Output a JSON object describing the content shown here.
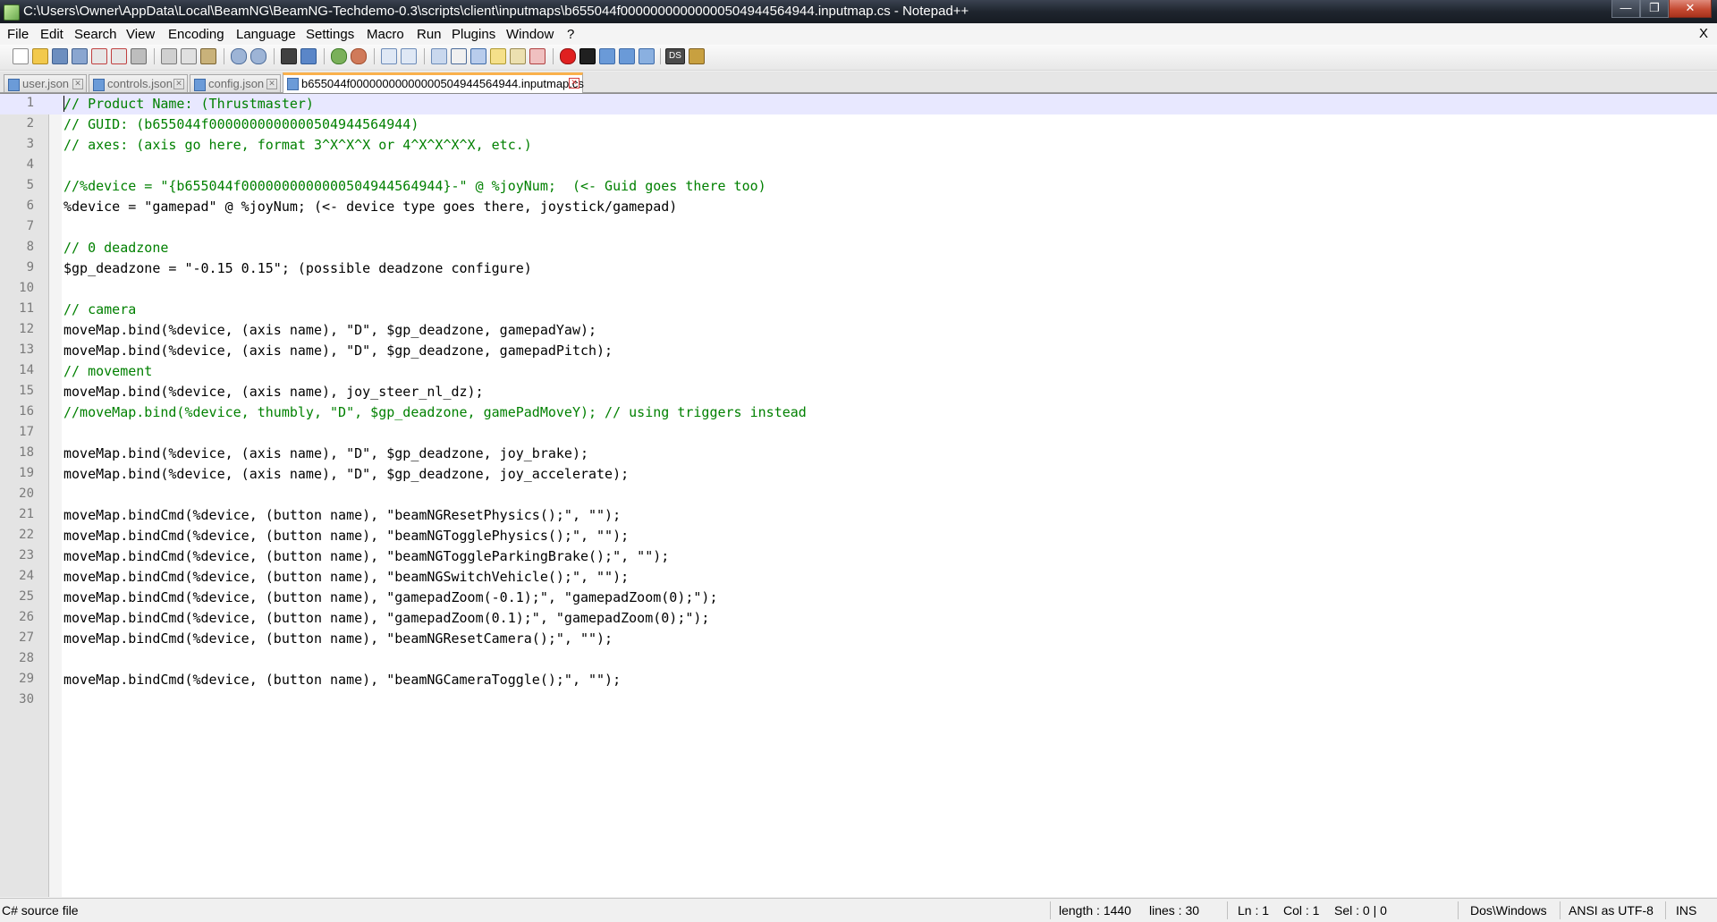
{
  "window": {
    "title": "C:\\Users\\Owner\\AppData\\Local\\BeamNG\\BeamNG-Techdemo-0.3\\scripts\\client\\inputmaps\\b655044f00000000000000504944564944.inputmap.cs - Notepad++",
    "minimize_label": "—",
    "maximize_label": "❐",
    "close_label": "✕"
  },
  "menu": {
    "items": [
      "File",
      "Edit",
      "Search",
      "View",
      "Encoding",
      "Language",
      "Settings",
      "Macro",
      "Run",
      "Plugins",
      "Window",
      "?"
    ],
    "close_label": "X"
  },
  "toolbar": {
    "icons": [
      "new-file-icon",
      "open-file-icon",
      "save-icon",
      "save-all-icon",
      "close-icon",
      "close-all-icon",
      "print-icon",
      "cut-icon",
      "copy-icon",
      "paste-icon",
      "undo-icon",
      "redo-icon",
      "find-icon",
      "replace-icon",
      "zoom-in-icon",
      "zoom-out-icon",
      "sync-vertical-icon",
      "sync-horizontal-icon",
      "word-wrap-icon",
      "show-all-chars-icon",
      "indent-guide-icon",
      "user-language-icon",
      "doc-map-icon",
      "function-list-icon",
      "record-macro-icon",
      "stop-macro-icon",
      "play-macro-icon",
      "run-macro-multiple-icon",
      "save-macro-icon",
      "ds-plugin-icon",
      "plugin-icon"
    ],
    "ds_label": "DS"
  },
  "tabs": [
    {
      "label": "user.json",
      "active": false
    },
    {
      "label": "controls.json",
      "active": false
    },
    {
      "label": "config.json",
      "active": false
    },
    {
      "label": "b655044f00000000000000504944564944.inputmap.cs",
      "active": true
    }
  ],
  "editor": {
    "lines": [
      {
        "n": "1",
        "text": "// Product Name: (Thrustmaster)",
        "kind": "comment"
      },
      {
        "n": "2",
        "text": "// GUID: (b655044f0000000000000504944564944)",
        "kind": "comment"
      },
      {
        "n": "3",
        "text": "// axes: (axis go here, format 3^X^X^X or 4^X^X^X^X, etc.)",
        "kind": "comment"
      },
      {
        "n": "4",
        "text": "",
        "kind": "code"
      },
      {
        "n": "5",
        "text": "//%device = \"{b655044f0000000000000504944564944}-\" @ %joyNum;  (<- Guid goes there too)",
        "kind": "comment"
      },
      {
        "n": "6",
        "text": "%device = \"gamepad\" @ %joyNum; (<- device type goes there, joystick/gamepad)",
        "kind": "code"
      },
      {
        "n": "7",
        "text": "",
        "kind": "code"
      },
      {
        "n": "8",
        "text": "// 0 deadzone",
        "kind": "comment"
      },
      {
        "n": "9",
        "text": "$gp_deadzone = \"-0.15 0.15\"; (possible deadzone configure)",
        "kind": "code"
      },
      {
        "n": "10",
        "text": "",
        "kind": "code"
      },
      {
        "n": "11",
        "text": "// camera",
        "kind": "comment"
      },
      {
        "n": "12",
        "text": "moveMap.bind(%device, (axis name), \"D\", $gp_deadzone, gamepadYaw);",
        "kind": "code"
      },
      {
        "n": "13",
        "text": "moveMap.bind(%device, (axis name), \"D\", $gp_deadzone, gamepadPitch);",
        "kind": "code"
      },
      {
        "n": "14",
        "text": "// movement",
        "kind": "comment"
      },
      {
        "n": "15",
        "text": "moveMap.bind(%device, (axis name), joy_steer_nl_dz);",
        "kind": "code"
      },
      {
        "n": "16",
        "text": "//moveMap.bind(%device, thumbly, \"D\", $gp_deadzone, gamePadMoveY); // using triggers instead",
        "kind": "comment"
      },
      {
        "n": "17",
        "text": "",
        "kind": "code"
      },
      {
        "n": "18",
        "text": "moveMap.bind(%device, (axis name), \"D\", $gp_deadzone, joy_brake);",
        "kind": "code"
      },
      {
        "n": "19",
        "text": "moveMap.bind(%device, (axis name), \"D\", $gp_deadzone, joy_accelerate);",
        "kind": "code"
      },
      {
        "n": "20",
        "text": "",
        "kind": "code"
      },
      {
        "n": "21",
        "text": "moveMap.bindCmd(%device, (button name), \"beamNGResetPhysics();\", \"\");",
        "kind": "code"
      },
      {
        "n": "22",
        "text": "moveMap.bindCmd(%device, (button name), \"beamNGTogglePhysics();\", \"\");",
        "kind": "code"
      },
      {
        "n": "23",
        "text": "moveMap.bindCmd(%device, (button name), \"beamNGToggleParkingBrake();\", \"\");",
        "kind": "code"
      },
      {
        "n": "24",
        "text": "moveMap.bindCmd(%device, (button name), \"beamNGSwitchVehicle();\", \"\");",
        "kind": "code"
      },
      {
        "n": "25",
        "text": "moveMap.bindCmd(%device, (button name), \"gamepadZoom(-0.1);\", \"gamepadZoom(0);\");",
        "kind": "code"
      },
      {
        "n": "26",
        "text": "moveMap.bindCmd(%device, (button name), \"gamepadZoom(0.1);\", \"gamepadZoom(0);\");",
        "kind": "code"
      },
      {
        "n": "27",
        "text": "moveMap.bindCmd(%device, (button name), \"beamNGResetCamera();\", \"\");",
        "kind": "code"
      },
      {
        "n": "28",
        "text": "",
        "kind": "code"
      },
      {
        "n": "29",
        "text": "moveMap.bindCmd(%device, (button name), \"beamNGCameraToggle();\", \"\");",
        "kind": "code"
      },
      {
        "n": "30",
        "text": "",
        "kind": "code"
      }
    ],
    "current_line": 1
  },
  "status": {
    "file_type": "C# source file",
    "length": "length : 1440",
    "lines": "lines : 30",
    "ln": "Ln : 1",
    "col": "Col : 1",
    "sel": "Sel : 0 | 0",
    "eol": "Dos\\Windows",
    "encoding": "ANSI as UTF-8",
    "mode": "INS"
  },
  "colors": {
    "comment": "#008000",
    "keyword": "#000080",
    "string": "#808080",
    "active_tab_accent": "#fab14c",
    "current_line": "#e8e8ff"
  }
}
